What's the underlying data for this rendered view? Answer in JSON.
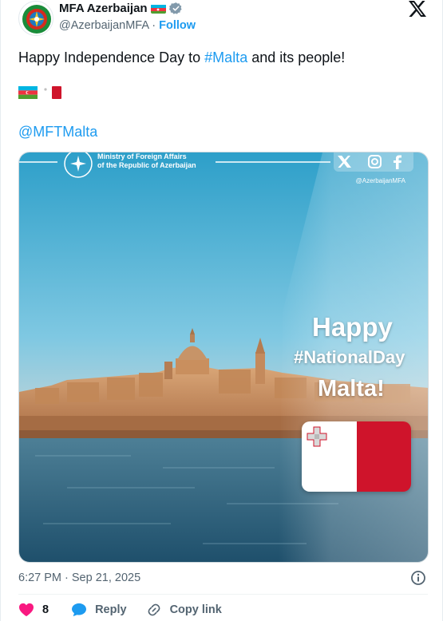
{
  "author": {
    "name": "MFA Azerbaijan",
    "handle": "@AzerbaijanMFA",
    "separator": " · ",
    "follow_label": "Follow"
  },
  "tweet": {
    "text_before": "Happy Independence Day to ",
    "hashtag": "#Malta",
    "text_after": " and its people!",
    "mention": "@MFTMalta"
  },
  "media": {
    "ministry_line1": "Ministry of Foreign Affairs",
    "ministry_line2": "of the Republic of Azerbaijan",
    "social_handle": "@AzerbaijanMFA",
    "happy": "Happy",
    "national": "#NationalDay",
    "malta": "Malta!"
  },
  "meta": {
    "timestamp": "6:27 PM · Sep 21, 2025"
  },
  "actions": {
    "like_count": "8",
    "reply_label": "Reply",
    "copy_label": "Copy link"
  },
  "colors": {
    "accent": "#1d9bf0",
    "like": "#f91880",
    "malta_red": "#cf142b"
  },
  "icons": [
    "azerbaijan-emblem-icon",
    "verified-badge-icon",
    "x-logo-icon",
    "info-icon",
    "heart-icon",
    "reply-bubble-icon",
    "link-icon"
  ]
}
